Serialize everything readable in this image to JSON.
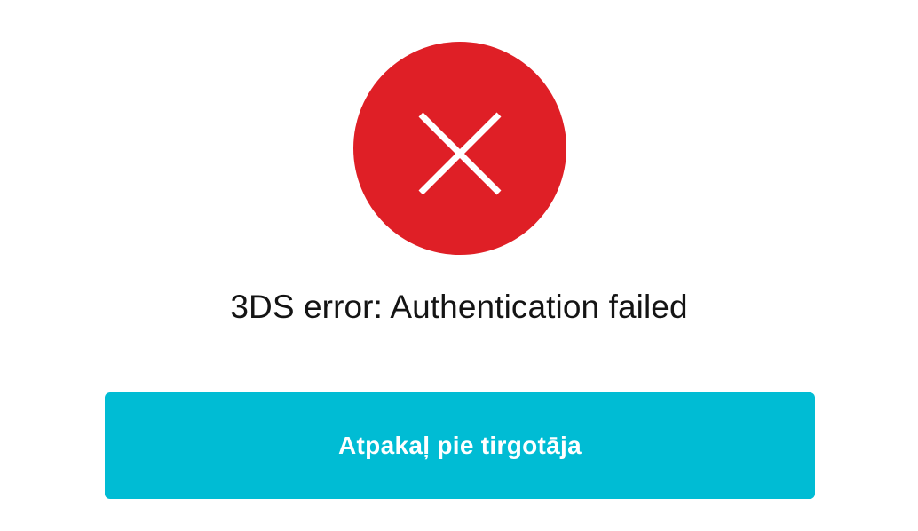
{
  "status": {
    "icon": "close-icon",
    "color": "#df1f26",
    "message": "3DS error: Authentication failed"
  },
  "actions": {
    "back_label": "Atpakaļ pie tirgotāja",
    "back_color": "#00bcd4"
  }
}
